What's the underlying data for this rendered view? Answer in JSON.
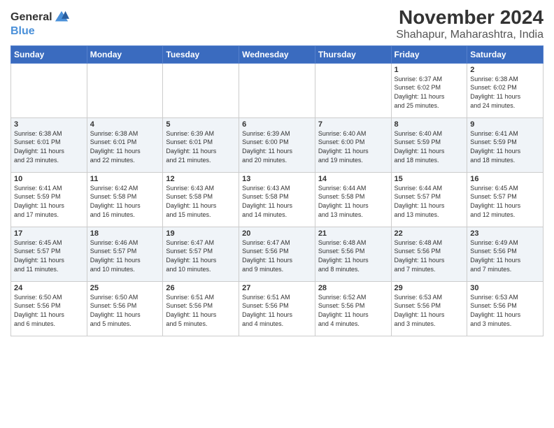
{
  "logo": {
    "general": "General",
    "blue": "Blue"
  },
  "title": "November 2024",
  "subtitle": "Shahapur, Maharashtra, India",
  "headers": [
    "Sunday",
    "Monday",
    "Tuesday",
    "Wednesday",
    "Thursday",
    "Friday",
    "Saturday"
  ],
  "weeks": [
    [
      {
        "day": "",
        "info": ""
      },
      {
        "day": "",
        "info": ""
      },
      {
        "day": "",
        "info": ""
      },
      {
        "day": "",
        "info": ""
      },
      {
        "day": "",
        "info": ""
      },
      {
        "day": "1",
        "info": "Sunrise: 6:37 AM\nSunset: 6:02 PM\nDaylight: 11 hours\nand 25 minutes."
      },
      {
        "day": "2",
        "info": "Sunrise: 6:38 AM\nSunset: 6:02 PM\nDaylight: 11 hours\nand 24 minutes."
      }
    ],
    [
      {
        "day": "3",
        "info": "Sunrise: 6:38 AM\nSunset: 6:01 PM\nDaylight: 11 hours\nand 23 minutes."
      },
      {
        "day": "4",
        "info": "Sunrise: 6:38 AM\nSunset: 6:01 PM\nDaylight: 11 hours\nand 22 minutes."
      },
      {
        "day": "5",
        "info": "Sunrise: 6:39 AM\nSunset: 6:01 PM\nDaylight: 11 hours\nand 21 minutes."
      },
      {
        "day": "6",
        "info": "Sunrise: 6:39 AM\nSunset: 6:00 PM\nDaylight: 11 hours\nand 20 minutes."
      },
      {
        "day": "7",
        "info": "Sunrise: 6:40 AM\nSunset: 6:00 PM\nDaylight: 11 hours\nand 19 minutes."
      },
      {
        "day": "8",
        "info": "Sunrise: 6:40 AM\nSunset: 5:59 PM\nDaylight: 11 hours\nand 18 minutes."
      },
      {
        "day": "9",
        "info": "Sunrise: 6:41 AM\nSunset: 5:59 PM\nDaylight: 11 hours\nand 18 minutes."
      }
    ],
    [
      {
        "day": "10",
        "info": "Sunrise: 6:41 AM\nSunset: 5:59 PM\nDaylight: 11 hours\nand 17 minutes."
      },
      {
        "day": "11",
        "info": "Sunrise: 6:42 AM\nSunset: 5:58 PM\nDaylight: 11 hours\nand 16 minutes."
      },
      {
        "day": "12",
        "info": "Sunrise: 6:43 AM\nSunset: 5:58 PM\nDaylight: 11 hours\nand 15 minutes."
      },
      {
        "day": "13",
        "info": "Sunrise: 6:43 AM\nSunset: 5:58 PM\nDaylight: 11 hours\nand 14 minutes."
      },
      {
        "day": "14",
        "info": "Sunrise: 6:44 AM\nSunset: 5:58 PM\nDaylight: 11 hours\nand 13 minutes."
      },
      {
        "day": "15",
        "info": "Sunrise: 6:44 AM\nSunset: 5:57 PM\nDaylight: 11 hours\nand 13 minutes."
      },
      {
        "day": "16",
        "info": "Sunrise: 6:45 AM\nSunset: 5:57 PM\nDaylight: 11 hours\nand 12 minutes."
      }
    ],
    [
      {
        "day": "17",
        "info": "Sunrise: 6:45 AM\nSunset: 5:57 PM\nDaylight: 11 hours\nand 11 minutes."
      },
      {
        "day": "18",
        "info": "Sunrise: 6:46 AM\nSunset: 5:57 PM\nDaylight: 11 hours\nand 10 minutes."
      },
      {
        "day": "19",
        "info": "Sunrise: 6:47 AM\nSunset: 5:57 PM\nDaylight: 11 hours\nand 10 minutes."
      },
      {
        "day": "20",
        "info": "Sunrise: 6:47 AM\nSunset: 5:56 PM\nDaylight: 11 hours\nand 9 minutes."
      },
      {
        "day": "21",
        "info": "Sunrise: 6:48 AM\nSunset: 5:56 PM\nDaylight: 11 hours\nand 8 minutes."
      },
      {
        "day": "22",
        "info": "Sunrise: 6:48 AM\nSunset: 5:56 PM\nDaylight: 11 hours\nand 7 minutes."
      },
      {
        "day": "23",
        "info": "Sunrise: 6:49 AM\nSunset: 5:56 PM\nDaylight: 11 hours\nand 7 minutes."
      }
    ],
    [
      {
        "day": "24",
        "info": "Sunrise: 6:50 AM\nSunset: 5:56 PM\nDaylight: 11 hours\nand 6 minutes."
      },
      {
        "day": "25",
        "info": "Sunrise: 6:50 AM\nSunset: 5:56 PM\nDaylight: 11 hours\nand 5 minutes."
      },
      {
        "day": "26",
        "info": "Sunrise: 6:51 AM\nSunset: 5:56 PM\nDaylight: 11 hours\nand 5 minutes."
      },
      {
        "day": "27",
        "info": "Sunrise: 6:51 AM\nSunset: 5:56 PM\nDaylight: 11 hours\nand 4 minutes."
      },
      {
        "day": "28",
        "info": "Sunrise: 6:52 AM\nSunset: 5:56 PM\nDaylight: 11 hours\nand 4 minutes."
      },
      {
        "day": "29",
        "info": "Sunrise: 6:53 AM\nSunset: 5:56 PM\nDaylight: 11 hours\nand 3 minutes."
      },
      {
        "day": "30",
        "info": "Sunrise: 6:53 AM\nSunset: 5:56 PM\nDaylight: 11 hours\nand 3 minutes."
      }
    ]
  ]
}
